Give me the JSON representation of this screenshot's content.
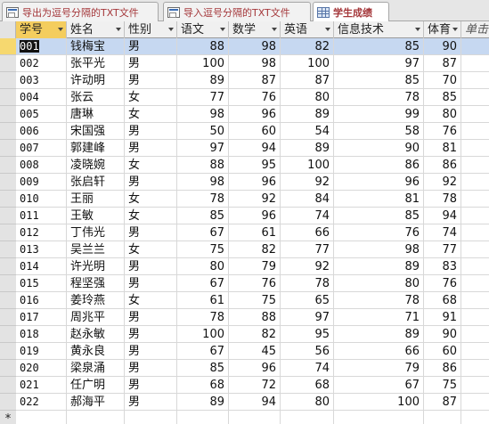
{
  "tabs": [
    {
      "label": "导出为逗号分隔的TXT文件",
      "icon": "form-icon"
    },
    {
      "label": "导入逗号分隔的TXT文件",
      "icon": "form-icon"
    },
    {
      "label": "学生成绩",
      "icon": "table-icon"
    }
  ],
  "new_row_marker": "*",
  "columns": [
    "学号",
    "姓名",
    "性别",
    "语文",
    "数学",
    "英语",
    "信息技术",
    "体育",
    "单击以添加"
  ],
  "rows": [
    [
      "001",
      "钱梅宝",
      "男",
      "88",
      "98",
      "82",
      "85",
      "90"
    ],
    [
      "002",
      "张平光",
      "男",
      "100",
      "98",
      "100",
      "97",
      "87"
    ],
    [
      "003",
      "许动明",
      "男",
      "89",
      "87",
      "87",
      "85",
      "70"
    ],
    [
      "004",
      "张云",
      "女",
      "77",
      "76",
      "80",
      "78",
      "85"
    ],
    [
      "005",
      "唐琳",
      "女",
      "98",
      "96",
      "89",
      "99",
      "80"
    ],
    [
      "006",
      "宋国强",
      "男",
      "50",
      "60",
      "54",
      "58",
      "76"
    ],
    [
      "007",
      "郭建峰",
      "男",
      "97",
      "94",
      "89",
      "90",
      "81"
    ],
    [
      "008",
      "凌晓婉",
      "女",
      "88",
      "95",
      "100",
      "86",
      "86"
    ],
    [
      "009",
      "张启轩",
      "男",
      "98",
      "96",
      "92",
      "96",
      "92"
    ],
    [
      "010",
      "王丽",
      "女",
      "78",
      "92",
      "84",
      "81",
      "78"
    ],
    [
      "011",
      "王敏",
      "女",
      "85",
      "96",
      "74",
      "85",
      "94"
    ],
    [
      "012",
      "丁伟光",
      "男",
      "67",
      "61",
      "66",
      "76",
      "74"
    ],
    [
      "013",
      "吴兰兰",
      "女",
      "75",
      "82",
      "77",
      "98",
      "77"
    ],
    [
      "014",
      "许光明",
      "男",
      "80",
      "79",
      "92",
      "89",
      "83"
    ],
    [
      "015",
      "程坚强",
      "男",
      "67",
      "76",
      "78",
      "80",
      "76"
    ],
    [
      "016",
      "姜玲燕",
      "女",
      "61",
      "75",
      "65",
      "78",
      "68"
    ],
    [
      "017",
      "周兆平",
      "男",
      "78",
      "88",
      "97",
      "71",
      "91"
    ],
    [
      "018",
      "赵永敏",
      "男",
      "100",
      "82",
      "95",
      "89",
      "90"
    ],
    [
      "019",
      "黄永良",
      "男",
      "67",
      "45",
      "56",
      "66",
      "60"
    ],
    [
      "020",
      "梁泉涌",
      "男",
      "85",
      "96",
      "74",
      "79",
      "86"
    ],
    [
      "021",
      "任广明",
      "男",
      "68",
      "72",
      "68",
      "67",
      "75"
    ],
    [
      "022",
      "郝海平",
      "男",
      "89",
      "94",
      "80",
      "100",
      "87"
    ]
  ]
}
